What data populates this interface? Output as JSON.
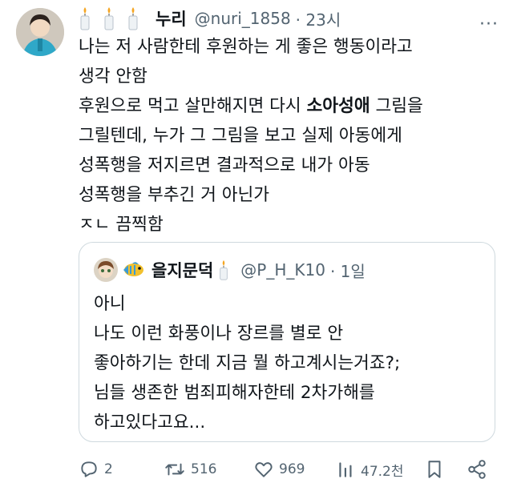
{
  "tweet": {
    "author_name": "누리",
    "author_handle": "@nuri_1858",
    "time": "· 23시",
    "more_label": "···",
    "lines": [
      {
        "parts": [
          {
            "text": "나는 저 사람한테 후원하는 게 좋은 행동이라고",
            "bold": false
          }
        ]
      },
      {
        "parts": [
          {
            "text": "생각 안함",
            "bold": false
          }
        ]
      },
      {
        "parts": [
          {
            "text": "후원으로 먹고 살만해지면 다시 ",
            "bold": false
          },
          {
            "text": "소아성애",
            "bold": true
          },
          {
            "text": " 그림을",
            "bold": false
          }
        ]
      },
      {
        "parts": [
          {
            "text": "그릴텐데, 누가 그 그림을 보고 실제 아동에게",
            "bold": false
          }
        ]
      },
      {
        "parts": [
          {
            "text": "성폭행을 저지르면 결과적으로 내가 아동",
            "bold": false
          }
        ]
      },
      {
        "parts": [
          {
            "text": "성폭행을 부추긴 거 아닌가",
            "bold": false
          }
        ]
      },
      {
        "parts": [
          {
            "text": "ㅈㄴ 끔찍함",
            "bold": false
          }
        ]
      }
    ]
  },
  "quote": {
    "author_name": "을지문덕",
    "author_handle": "@P_H_K10",
    "time": "· 1일",
    "lines": [
      "아니",
      "나도 이런 화풍이나 장르를 별로 안",
      "좋아하기는 한데 지금 뭘 하고계시는거죠?;",
      "님들 생존한 범죄피해자한테 2차가해를",
      "하고있다고요..."
    ]
  },
  "actions": {
    "reply_count": "2",
    "retweet_count": "516",
    "like_count": "969",
    "view_count": "47.2천"
  }
}
